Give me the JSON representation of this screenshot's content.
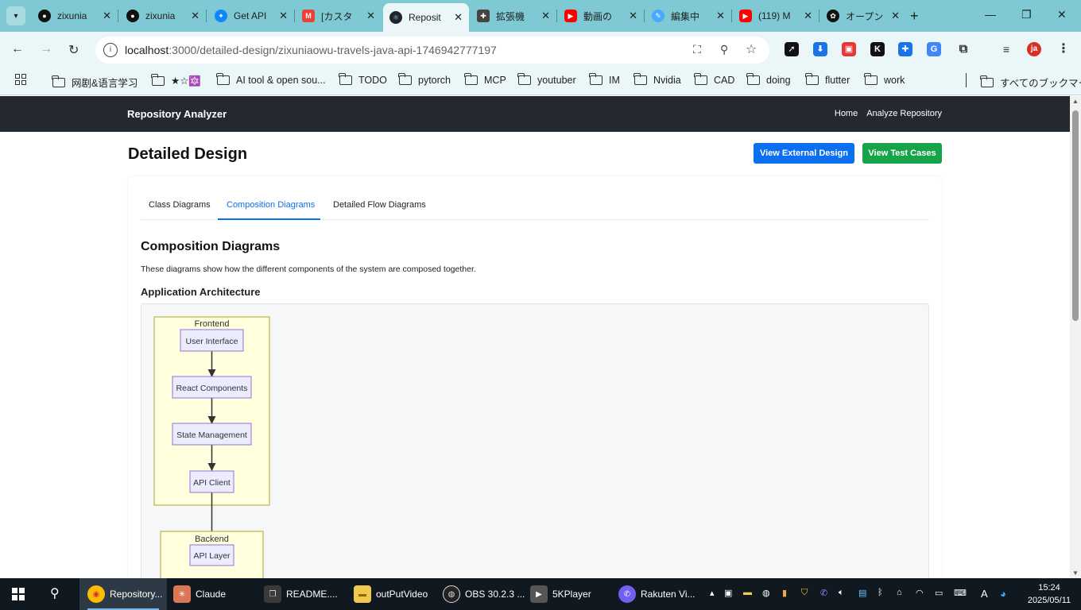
{
  "browser": {
    "tabs": [
      {
        "title": "zixunia",
        "icon": "github-icon",
        "color": "#111111"
      },
      {
        "title": "zixunia",
        "icon": "github-icon",
        "color": "#111111"
      },
      {
        "title": "Get API",
        "icon": "bluesky-icon",
        "color": "#1185fe"
      },
      {
        "title": "[カスタ",
        "icon": "gmail-icon",
        "color": "#ea4335"
      },
      {
        "title": "Reposit",
        "icon": "react-icon",
        "color": "#20232a",
        "active": true
      },
      {
        "title": "拡張機",
        "icon": "puzzle-icon",
        "color": "#333333"
      },
      {
        "title": "動画の",
        "icon": "youtube-icon",
        "color": "#ff0000"
      },
      {
        "title": "編集中",
        "icon": "edit-icon",
        "color": "#4aa8ff"
      },
      {
        "title": "(119) M",
        "icon": "youtube-icon",
        "color": "#ff0000"
      },
      {
        "title": "オープン",
        "icon": "openai-icon",
        "color": "#111111"
      }
    ],
    "url_host": "localhost",
    "url_path": ":3000/detailed-design/zixuniaowu-travels-java-api-1746942777197",
    "profile_initials": "ja",
    "bookmarks": [
      "网剧&语言学习",
      "★☆🔯",
      "AI tool & open sou...",
      "TODO",
      "pytorch",
      "MCP",
      "youtuber",
      "IM",
      "Nvidia",
      "CAD",
      "doing",
      "flutter",
      "work"
    ],
    "all_bookmarks": "すべてのブックマーク"
  },
  "app": {
    "brand": "Repository Analyzer",
    "nav": {
      "home": "Home",
      "analyze": "Analyze Repository"
    },
    "page_title": "Detailed Design",
    "buttons": {
      "external": "View External Design",
      "tests": "View Test Cases"
    },
    "tabs": [
      "Class Diagrams",
      "Composition Diagrams",
      "Detailed Flow Diagrams"
    ],
    "active_tab": "Composition Diagrams",
    "section_title": "Composition Diagrams",
    "section_desc": "These diagrams show how the different components of the system are composed together.",
    "diagram_title": "Application Architecture",
    "diagram": {
      "frontend_label": "Frontend",
      "frontend_nodes": [
        "User Interface",
        "React Components",
        "State Management",
        "API Client"
      ],
      "backend_label": "Backend",
      "backend_nodes": [
        "API Layer"
      ],
      "colors": {
        "group_fill": "#ffffde",
        "group_stroke": "#aaaa33",
        "node_fill": "#ececff",
        "node_stroke": "#9370db",
        "edge": "#333333"
      }
    }
  },
  "taskbar": {
    "items": [
      {
        "label": "Repository...",
        "icon": "chrome-icon",
        "active": true
      },
      {
        "label": "Claude",
        "icon": "claude-icon"
      },
      {
        "label": "README....",
        "icon": "app-icon"
      },
      {
        "label": "outPutVideo",
        "icon": "folder-icon"
      },
      {
        "label": "OBS 30.2.3 ...",
        "icon": "obs-icon"
      },
      {
        "label": "5KPlayer",
        "icon": "player-icon"
      },
      {
        "label": "Rakuten Vi...",
        "icon": "viber-icon"
      }
    ],
    "ime": "A",
    "time": "15:24",
    "date": "2025/05/11"
  }
}
